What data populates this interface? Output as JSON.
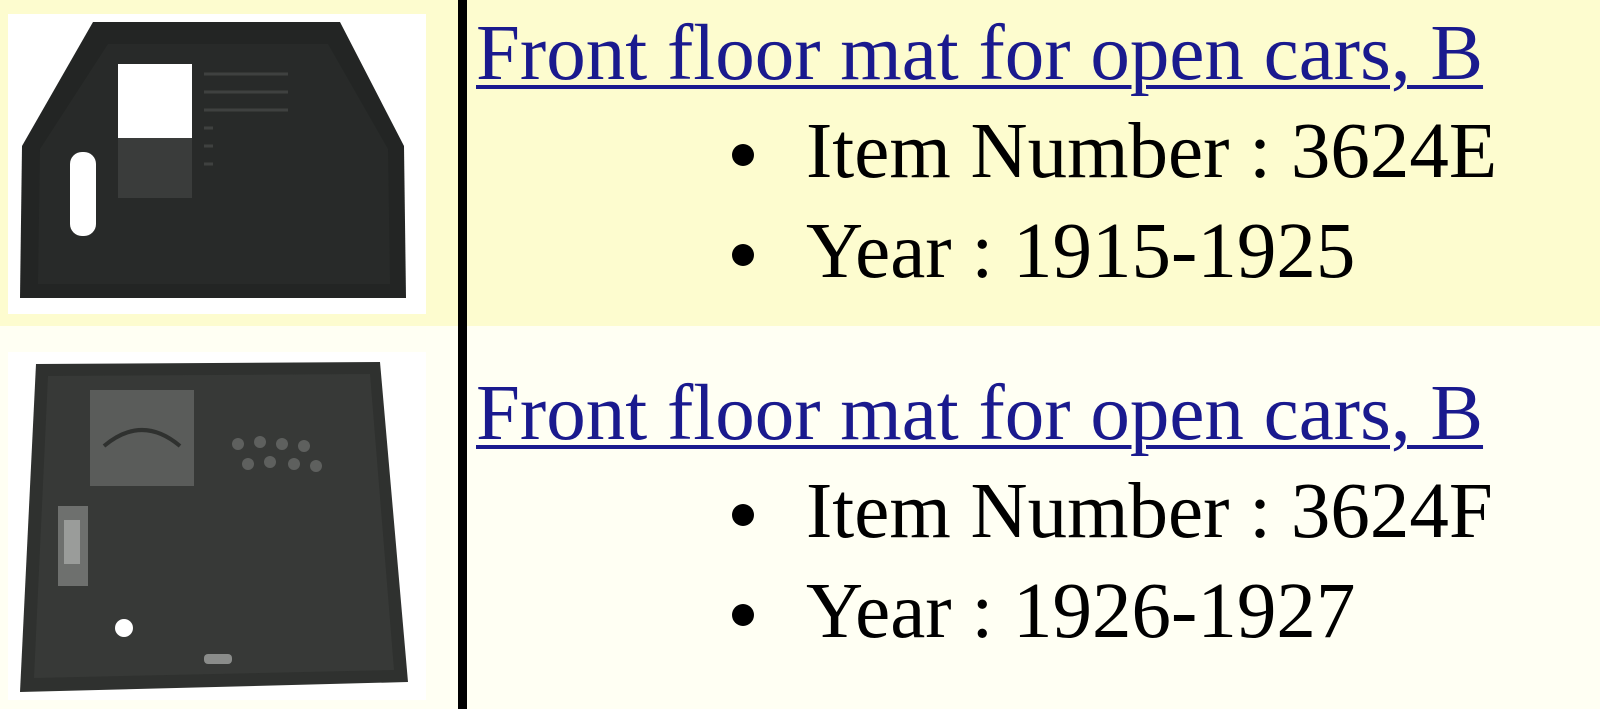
{
  "products": [
    {
      "image_alt": "front floor mat, open cars 1915-1925",
      "title": "Front floor mat for open cars, B",
      "item_number_label": "Item Number : 3624E",
      "year_label": "Year : 1915-1925"
    },
    {
      "image_alt": "front floor mat, open cars 1926-1927",
      "title": "Front floor mat for open cars, B",
      "item_number_label": "Item Number : 3624F",
      "year_label": "Year : 1926-1927"
    }
  ]
}
